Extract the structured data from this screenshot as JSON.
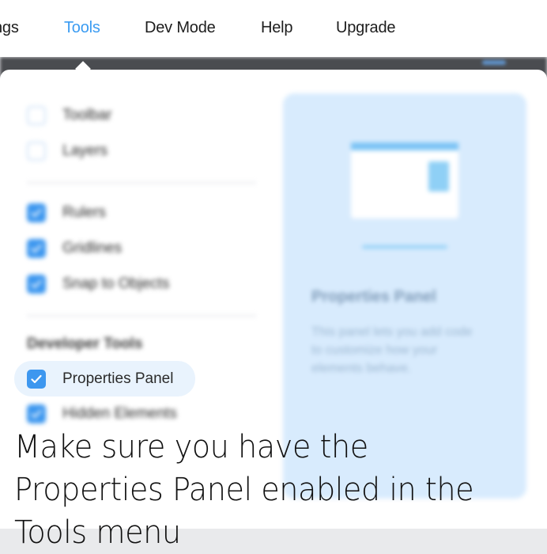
{
  "menubar": {
    "items": [
      {
        "label": "ngs",
        "active": false
      },
      {
        "label": "Tools",
        "active": true
      },
      {
        "label": "Dev Mode",
        "active": false
      },
      {
        "label": "Help",
        "active": false
      },
      {
        "label": "Upgrade",
        "active": false
      }
    ]
  },
  "tools_menu": {
    "items": [
      {
        "label": "Toolbar",
        "checked": false
      },
      {
        "label": "Layers",
        "checked": false
      },
      {
        "label": "Rulers",
        "checked": true
      },
      {
        "label": "Gridlines",
        "checked": true
      },
      {
        "label": "Snap to Objects",
        "checked": true
      }
    ],
    "section_title": "Developer Tools",
    "dev_items": [
      {
        "label": "Properties Panel",
        "checked": true,
        "highlighted": true
      },
      {
        "label": "Hidden Elements",
        "checked": true
      }
    ]
  },
  "info_card": {
    "title": "Properties Panel",
    "description": "This panel lets you add code to customize how your elements behave."
  },
  "caption": {
    "text": "Make sure you have the Properties Panel enabled in the Tools menu"
  },
  "colors": {
    "accent": "#3b9cf2",
    "checkbox": "#3d97ef",
    "card_bg": "#d8ebfd",
    "highlight_bg": "#e9f3fd"
  }
}
